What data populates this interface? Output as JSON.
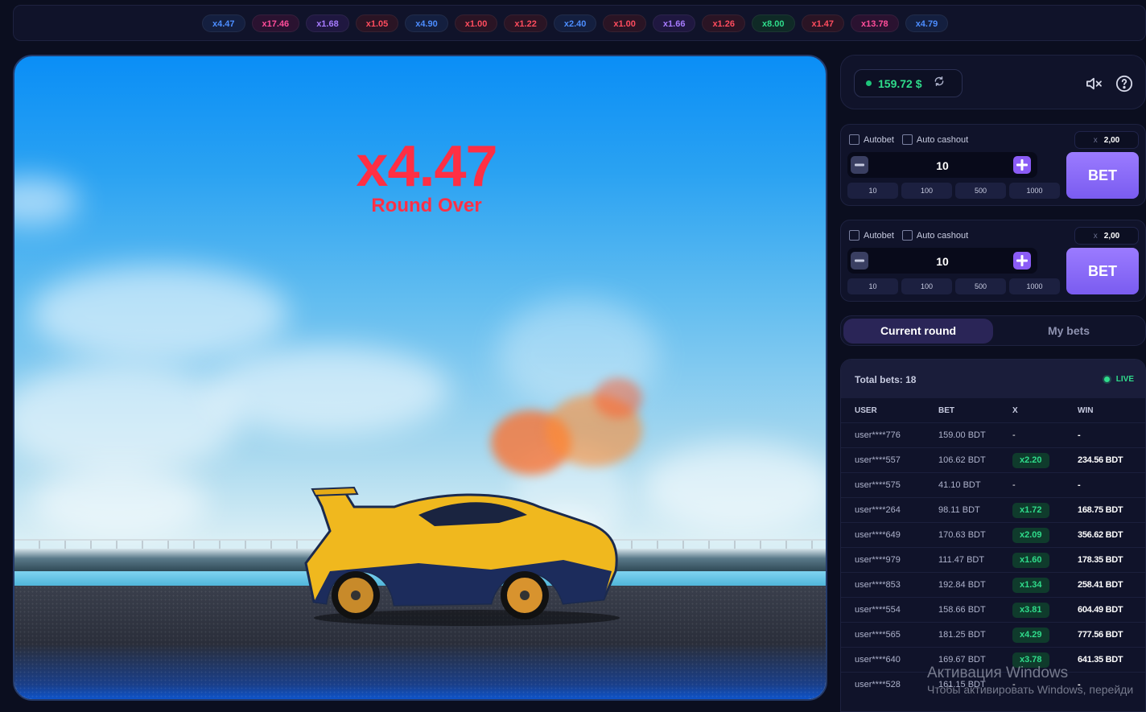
{
  "history": [
    {
      "label": "x4.47",
      "color": "blue"
    },
    {
      "label": "x17.46",
      "color": "pink"
    },
    {
      "label": "x1.68",
      "color": "purple"
    },
    {
      "label": "x1.05",
      "color": "red"
    },
    {
      "label": "x4.90",
      "color": "blue"
    },
    {
      "label": "x1.00",
      "color": "red"
    },
    {
      "label": "x1.22",
      "color": "red"
    },
    {
      "label": "x2.40",
      "color": "blue"
    },
    {
      "label": "x1.00",
      "color": "red"
    },
    {
      "label": "x1.66",
      "color": "purple"
    },
    {
      "label": "x1.26",
      "color": "red"
    },
    {
      "label": "x8.00",
      "color": "green"
    },
    {
      "label": "x1.47",
      "color": "red"
    },
    {
      "label": "x13.78",
      "color": "pink"
    },
    {
      "label": "x4.79",
      "color": "blue"
    }
  ],
  "game": {
    "multiplier": "x4.47",
    "status": "Round Over"
  },
  "balance": {
    "amount": "159.72 $"
  },
  "bet_panels": [
    {
      "autobet_label": "Autobet",
      "auto_cashout_label": "Auto cashout",
      "cashout_prefix": "x",
      "cashout_value": "2,00",
      "amount": "10",
      "quick_amounts": [
        "10",
        "100",
        "500",
        "1000"
      ],
      "bet_label": "BET"
    },
    {
      "autobet_label": "Autobet",
      "auto_cashout_label": "Auto cashout",
      "cashout_prefix": "x",
      "cashout_value": "2,00",
      "amount": "10",
      "quick_amounts": [
        "10",
        "100",
        "500",
        "1000"
      ],
      "bet_label": "BET"
    }
  ],
  "tabs": {
    "current": "Current round",
    "mine": "My bets"
  },
  "bets": {
    "total_label": "Total bets: 18",
    "live_label": "LIVE",
    "columns": {
      "user": "USER",
      "bet": "BET",
      "x": "X",
      "win": "WIN"
    },
    "rows": [
      {
        "user": "user****776",
        "bet": "159.00 BDT",
        "x": "-",
        "win": "-"
      },
      {
        "user": "user****557",
        "bet": "106.62 BDT",
        "x": "x2.20",
        "win": "234.56 BDT"
      },
      {
        "user": "user****575",
        "bet": "41.10 BDT",
        "x": "-",
        "win": "-"
      },
      {
        "user": "user****264",
        "bet": "98.11 BDT",
        "x": "x1.72",
        "win": "168.75 BDT"
      },
      {
        "user": "user****649",
        "bet": "170.63 BDT",
        "x": "x2.09",
        "win": "356.62 BDT"
      },
      {
        "user": "user****979",
        "bet": "111.47 BDT",
        "x": "x1.60",
        "win": "178.35 BDT"
      },
      {
        "user": "user****853",
        "bet": "192.84 BDT",
        "x": "x1.34",
        "win": "258.41 BDT"
      },
      {
        "user": "user****554",
        "bet": "158.66 BDT",
        "x": "x3.81",
        "win": "604.49 BDT"
      },
      {
        "user": "user****565",
        "bet": "181.25 BDT",
        "x": "x4.29",
        "win": "777.56 BDT"
      },
      {
        "user": "user****640",
        "bet": "169.67 BDT",
        "x": "x3.78",
        "win": "641.35 BDT"
      },
      {
        "user": "user****528",
        "bet": "161.15 BDT",
        "x": "-",
        "win": "-"
      }
    ]
  },
  "watermark": {
    "title": "Активация Windows",
    "subtitle": "Чтобы активировать Windows, перейди"
  },
  "icons": {
    "refresh": "refresh-icon",
    "sound": "mute-icon",
    "help": "help-icon"
  },
  "colors": {
    "accent": "#8b5cf6",
    "win_green": "#2fdc8b",
    "crash_red": "#ff2f44"
  }
}
